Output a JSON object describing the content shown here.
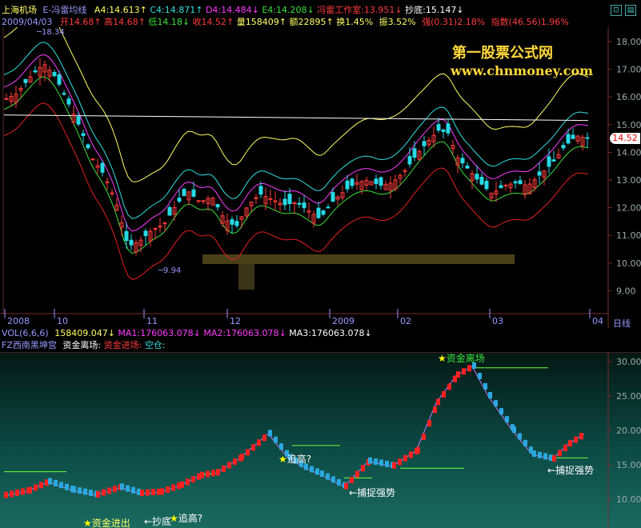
{
  "header": {
    "stock_name": "上海机场",
    "formula_name": "E-冯雷均线",
    "a4": "A4:14.613",
    "c4": "C4:14.871",
    "d4": "D4:14.484",
    "e4": "E4:14.208",
    "fl_work": "冯雷工作室:13.951",
    "chaodi": "抄底:15.147",
    "date": "2009/04/03",
    "open": "开14.68",
    "high": "高14.68",
    "low": "低14.18",
    "close": "收14.52",
    "volume": "量158409",
    "amount": "额22895",
    "turnover": "换1.45%",
    "amplitude": "振3.52%",
    "strength": "强(0.31)2.18%",
    "index": "指数(46.56)1.96%"
  },
  "watermark": {
    "title": "第一股票公式网",
    "url": "www.chnmoney.com"
  },
  "main_chart": {
    "y_ticks": [
      "18.00",
      "17.00",
      "16.00",
      "15.00",
      "14.00",
      "13.00",
      "12.00",
      "11.00",
      "10.00",
      "9.00"
    ],
    "x_ticks": [
      "2008",
      "10",
      "11",
      "12",
      "2009",
      "02",
      "03",
      "04"
    ],
    "period_label": "日线",
    "high_mark": "18.34",
    "low_mark": "9.94",
    "price_tag": "14.52",
    "colors": {
      "up": "#ff3c3c",
      "down": "#27d9e6",
      "bands": [
        "#ffff66",
        "#31e0e0",
        "#ff3cff",
        "#3ce03c",
        "#e62020",
        "#ffffff"
      ]
    }
  },
  "volume_header": {
    "vol": "VOL(6,6,6)",
    "vol_val": "158409.047",
    "ma1": "MA1:176063.078",
    "ma2": "MA2:176063.078",
    "ma3": "MA3:176063.078"
  },
  "indicator": {
    "name": "FZ西南黑坤宫",
    "out": "资金离场:",
    "in": "资金进场:",
    "empty": "空仓:",
    "y_ticks": [
      "30.00",
      "25.00",
      "20.00",
      "15.00",
      "10.00"
    ],
    "annotations": {
      "a1": "资金进出",
      "a2": "←抄底",
      "a3": "追高?",
      "a4": "追高?",
      "a5": "←捕捉强势",
      "a6": "资金离场",
      "a7": "←捕捉强势"
    }
  }
}
